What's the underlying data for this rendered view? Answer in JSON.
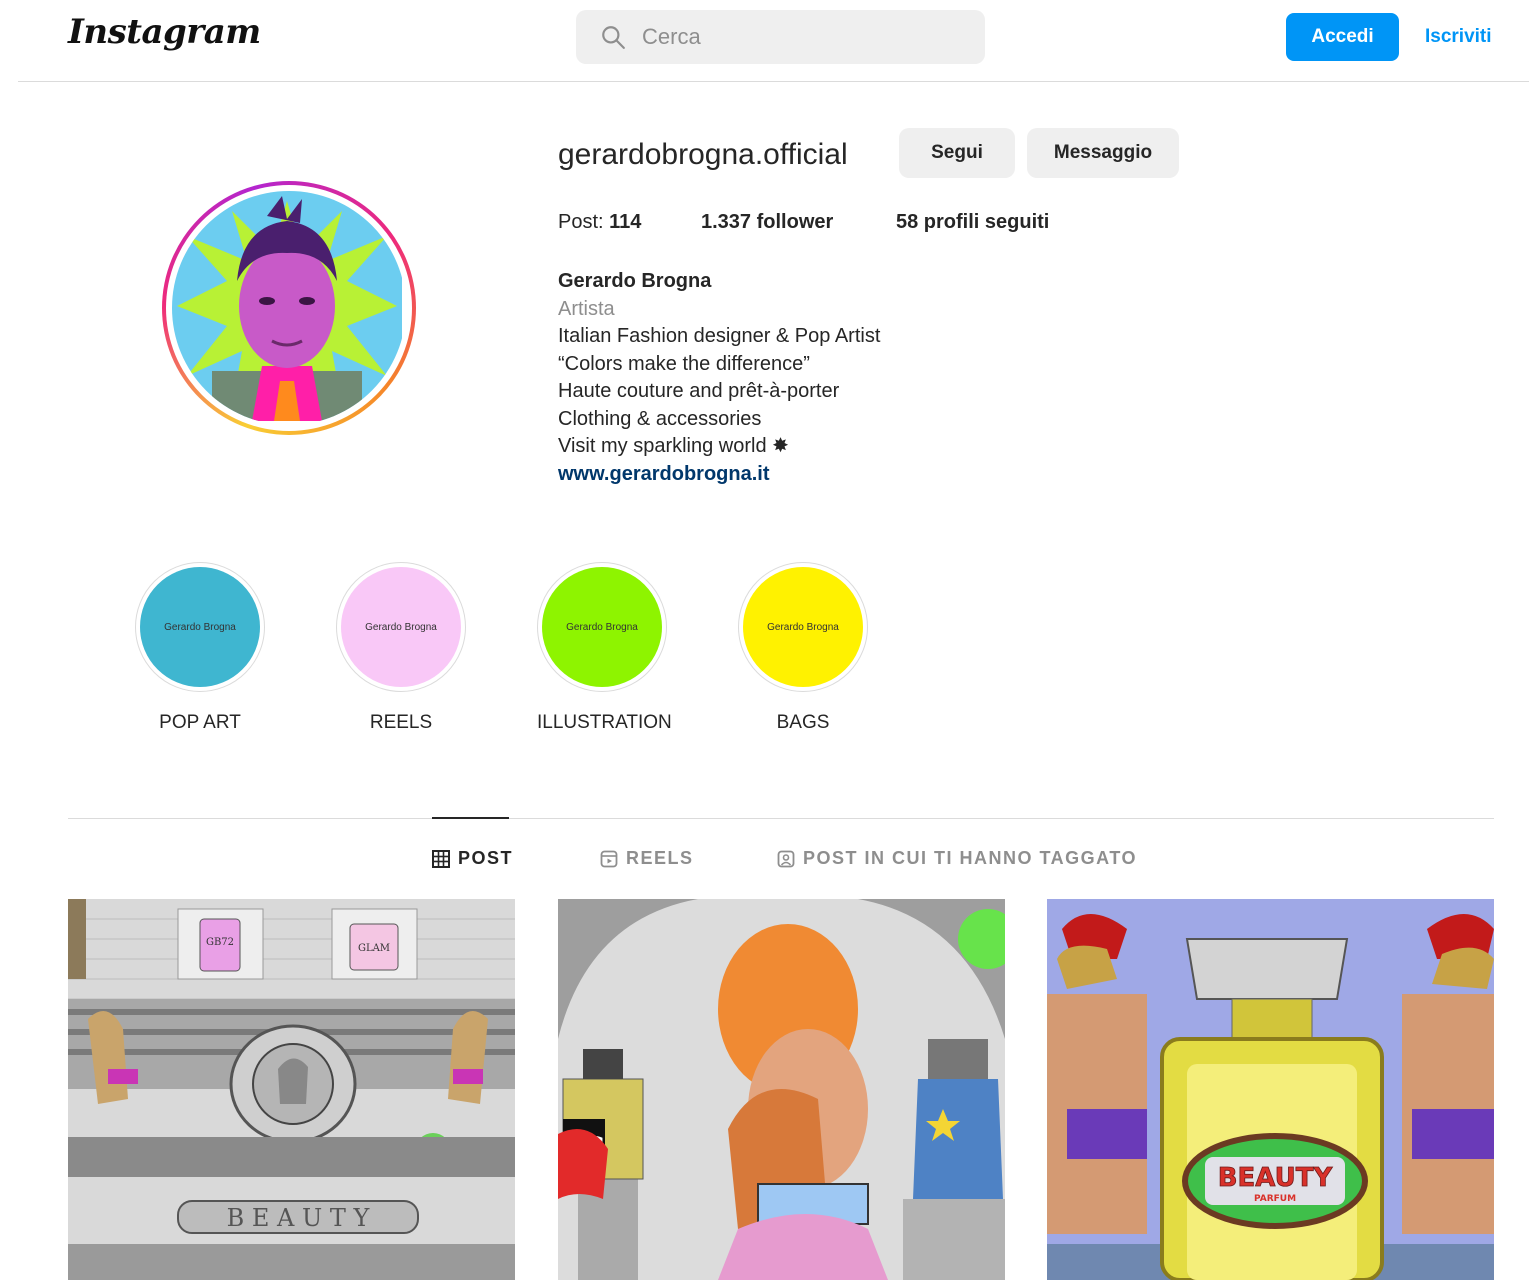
{
  "header": {
    "logo": "Instagram",
    "search_placeholder": "Cerca",
    "login_label": "Accedi",
    "signup_label": "Iscriviti",
    "accent_color": "#0095f6"
  },
  "profile": {
    "username": "gerardobrogna.official",
    "follow_label": "Segui",
    "message_label": "Messaggio",
    "stats": {
      "posts_label": "Post: ",
      "posts_count": "114",
      "followers_count": "1.337",
      "followers_label": " follower",
      "following_count": "58",
      "following_label": " profili seguiti"
    },
    "bio": {
      "name": "Gerardo Brogna",
      "category": "Artista",
      "lines": [
        "Italian Fashion designer & Pop Artist",
        "“Colors make the difference”",
        "Haute couture and prêt-à-porter",
        "Clothing & accessories",
        "Visit my sparkling world ✸"
      ],
      "website": "www.gerardobrogna.it"
    }
  },
  "highlights": [
    {
      "label": "POP ART",
      "inner_text": "Gerardo Brogna",
      "color": "#3fb6d0"
    },
    {
      "label": "REELS",
      "inner_text": "Gerardo Brogna",
      "color": "#f9c8f7"
    },
    {
      "label": "ILLUSTRATION",
      "inner_text": "Gerardo Brogna",
      "color": "#8ef400"
    },
    {
      "label": "BAGS",
      "inner_text": "Gerardo Brogna",
      "color": "#fff200"
    }
  ],
  "tabs": [
    {
      "label": "POST",
      "icon": "grid-icon",
      "active": true
    },
    {
      "label": "REELS",
      "icon": "reels-icon",
      "active": false
    },
    {
      "label": "POST IN CUI TI HANNO TAGGATO",
      "icon": "tagged-icon",
      "active": false
    }
  ],
  "posts": [
    {
      "sign_text": "B E A U T Y",
      "bottle_labels": [
        "GB72",
        "GLAM"
      ]
    },
    {
      "bottle_label": "G"
    },
    {
      "sign_text": "BEAUTY",
      "sign_subtext": "PARFUM"
    }
  ]
}
